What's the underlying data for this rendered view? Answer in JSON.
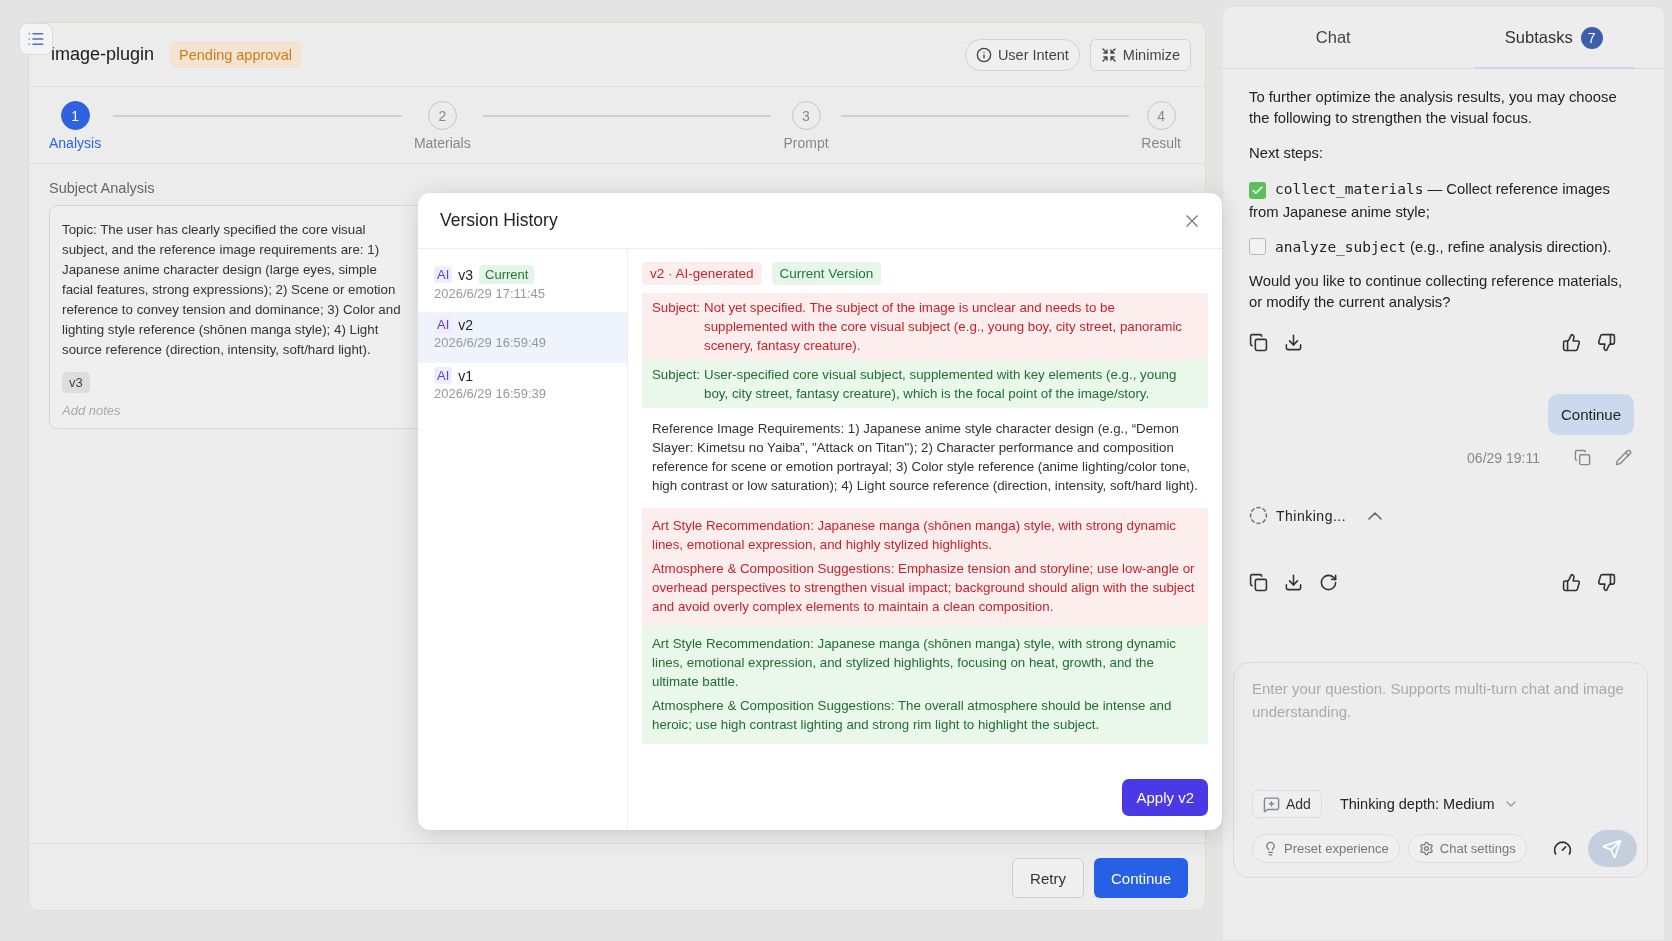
{
  "header": {
    "title": "image-plugin",
    "status": "Pending approval",
    "buttons": [
      {
        "label": "User Intent",
        "kind": "info"
      },
      {
        "label": "Minimize",
        "kind": "minimize"
      }
    ]
  },
  "steps": [
    {
      "number": "1",
      "label": "Analysis",
      "selected": true
    },
    {
      "number": "2",
      "label": "Materials",
      "selected": false
    },
    {
      "number": "3",
      "label": "Prompt",
      "selected": false
    },
    {
      "number": "4",
      "label": "Result",
      "selected": false
    }
  ],
  "section_title": "Subject Analysis",
  "analysis": {
    "text": "Topic: The user has clearly specified the core visual subject, and the reference image requirements are: 1) Japanese anime character design (large eyes, simple facial features, strong expressions); 2) Scene or emotion reference to convey tension and dominance; 3) Color and lighting style reference (shōnen manga style); 4) Light source reference (direction, intensity, soft/hard light).",
    "version_tag": "v3",
    "notes_placeholder": "Add notes"
  },
  "footer_buttons": [
    {
      "label": "Retry",
      "kind": "secondary"
    },
    {
      "label": "Continue",
      "kind": "primary"
    }
  ],
  "modal": {
    "title": "Version History",
    "versions": [
      {
        "badge": "AI",
        "name": "v3",
        "current_label": "Current",
        "time": "2026/6/29 17:11:45",
        "selected": false
      },
      {
        "badge": "AI",
        "name": "v2",
        "time": "2026/6/29 16:59:49",
        "selected": true
      },
      {
        "badge": "AI",
        "name": "v1",
        "time": "2026/6/29 16:59:39",
        "selected": false
      }
    ],
    "tags": [
      {
        "label": "v2 · AI-generated",
        "kind": "removed"
      },
      {
        "label": "Current Version",
        "kind": "added"
      }
    ],
    "blocks": [
      {
        "kind": "removed",
        "label": "Subject:",
        "paragraphs": [
          "Not yet specified. The subject of the image is unclear and needs to be supplemented with the core visual subject (e.g., young boy, city street, panoramic scenery, fantasy creature)."
        ]
      },
      {
        "kind": "added",
        "label": "Subject:",
        "paragraphs": [
          "User-specified core visual subject, supplemented with key elements (e.g., young boy, city street, fantasy creature), which is the focal point of the image/story."
        ]
      },
      {
        "kind": "plain",
        "paragraphs": [
          "Reference Image Requirements: 1) Japanese anime style character design (e.g., “Demon Slayer: Kimetsu no Yaiba”, \"Attack on Titan\"); 2) Character performance and composition reference for scene or emotion portrayal; 3) Color style reference (anime lighting/color tone, high contrast or low saturation); 4) Light source reference (direction, intensity, soft/hard light)."
        ]
      },
      {
        "kind": "removed",
        "paragraphs": [
          "Art Style Recommendation: Japanese manga (shōnen manga) style, with strong dynamic lines, emotional expression, and highly stylized highlights.",
          "Atmosphere & Composition Suggestions: Emphasize tension and storyline; use low-angle or overhead perspectives to strengthen visual impact; background should align with the subject and avoid overly complex elements to maintain a clean composition."
        ]
      },
      {
        "kind": "added",
        "paragraphs": [
          "Art Style Recommendation: Japanese manga (shōnen manga) style, with strong dynamic lines, emotional expression, and stylized highlights, focusing on heat, growth, and the ultimate battle.",
          "Atmosphere & Composition Suggestions: The overall atmosphere should be intense and heroic; use high contrast lighting and strong rim light to highlight the subject."
        ]
      }
    ],
    "apply_button": "Apply v2"
  },
  "chat_panel": {
    "tabs": [
      {
        "label": "Chat",
        "selected": false
      },
      {
        "label": "Subtasks",
        "count": "7",
        "selected": true
      }
    ],
    "intro": "To further optimize the analysis results, you may choose the following to strengthen the visual focus.",
    "next_steps_label": "Next steps:",
    "tasks": [
      {
        "code": "collect_materials",
        "text": "— Collect reference images from Japanese anime style;",
        "checked": true
      },
      {
        "code": "analyze_subject",
        "text": "(e.g., refine analysis direction).",
        "checked": false
      }
    ],
    "question": "Would you like to continue collecting reference materials, or modify the current analysis?",
    "user_message": {
      "text": "Continue",
      "time": "06/29 19:11"
    },
    "thinking": {
      "label": "Thinking...",
      "expanded": true
    },
    "input": {
      "placeholder": "Enter your question. Supports multi-turn chat and image understanding.",
      "add_label": "Add",
      "depth_label": "Thinking depth: Medium",
      "chips": [
        "Preset experience",
        "Chat settings"
      ]
    }
  }
}
